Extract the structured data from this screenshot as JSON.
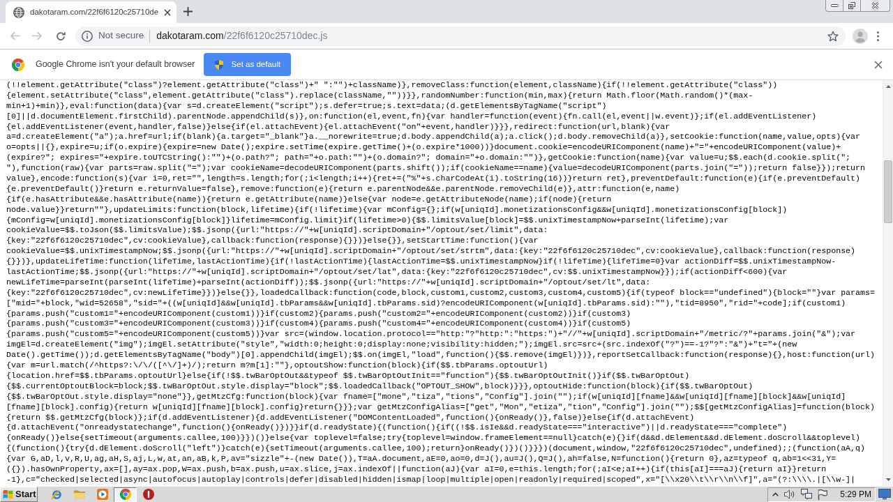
{
  "tabs": [
    {
      "title": "dakotaram.com/22f6f6120c25710de",
      "selected": true
    }
  ],
  "nav_buttons": [
    {
      "kind": "back",
      "disabled": true
    },
    {
      "kind": "forward",
      "disabled": true
    },
    {
      "kind": "reload",
      "disabled": false
    }
  ],
  "address_bar": {
    "security_label": "Not secure",
    "url": "dakotaram.com/22f6f6120c25710dec.js"
  },
  "infobar": {
    "message": "Google Chrome isn't your default browser",
    "button": "Set as default"
  },
  "code_lines": [
    "(!!element.getAttribute(\"class\")?element.getAttribute(\"class\")+\" \":\"\")+className)},removeClass:function(element,className){if(!!element.getAttribute(\"class\"))",
    "{element.setAttribute(\"class\",element.getAttribute(\"class\").replace(className,\"\"))}},randomNumber:function(min,max){return Math.floor(Math.random()*(max-",
    "min+1)+min)},eval:function(data){var s=d.createElement(\"script\");s.defer=true;s.text=data;(d.getElementsByTagName(\"script\")",
    "[0]||d.documentElement.firstChild).parentNode.appendChild(s)},on:function(el,event,fn){var handler=function(event){fn.call(el,event||w.event)};if(el.addEventListener)",
    "{el.addEventListener(event,handler,false)}else{if(el.attachEvent){el.attachEvent(\"on\"+event,handler)}}},redirect:function(url,blank){var",
    "a=d.createElement(\"a\");a.href=url;if(blank){a.target=\"_blank\"}a.__norewrite=true;d.body.appendChild(a);a.click();d.body.removeChild(a)},setCookie:function(name,value,opts){var",
    "o=opts||{},expire=u;if(o.expire){expire=new Date();expire.setTime(expire.getTime()+(o.expire*1000))}document.cookie=encodeURIComponent(name)+\"=\"+encodeURIComponent(value)+",
    "(expire?\"; expires=\"+expire.toUTCString():\"\")+(o.path?\"; path=\"+o.path:\"\")+(o.domain?\"; domain=\"+o.domain:\"\")},getCookie:function(name){var value=u;$$.each(d.cookie.split(\";",
    "\"),function(raw){var parts=raw.split(\"=\");var cookieName=decodeURIComponent(parts.shift());if(cookieName==name){value=decodeURIComponent(parts.join(\"=\"));return false}});return",
    "value},encode:function(s){var i=0,ret=\"\",length=s.length;for(;i<length;i++){ret+=(\"%\"+s.charCodeAt(i).toString(16))}return ret},preventDefault:function(e){if(e.preventDefault)",
    "{e.preventDefault()}return e.returnValue=false},remove:function(e){return e.parentNode&&e.parentNode.removeChild(e)},attr:function(e,name)",
    "{if(e.hasAttribute&&e.hasAttribute(name)){return e.getAttribute(name)}else{var node=e.getAttributeNode(name);if(node){return",
    "node.value}}return\"\"},updateLimits:function(block,lifetime){if(!lifetime){var mConfig={};if(w[uniqId].monetizationsConfig&&w[uniqId].monetizationsConfig[block])",
    "{mConfig=w[uniqId].monetizationsConfig[block]}lifetime=mConfig.limit}if(lifetime>0){$$.limitsValue[block]=$$.unixTimestampNow+parseInt(lifetime);var",
    "cookieValue=$$.toJson($$.limitsValue);$$.jsonp({url:\"https://\"+w[uniqId].scriptDomain+\"/optout/set/limit\",data:",
    "{key:\"22f6f6120c25710dec\",cv:cookieValue},callback:function(response){}})}else{}},setStartTime:function(){var",
    "cookieValue=$$.unixTimestampNow;$$.jsonp({url:\"https://\"+w[uniqId].scriptDomain+\"/optout/set/strtm\",data:{key:\"22f6f6120c25710dec\",cv:cookieValue},callback:function(response)",
    "{}})},updateLifeTime:function(lifeTime,lastActionTime){if(!lastActionTime){lastActionTime=$$.unixTimestampNow}if(!lifeTime){lifeTime=0}var actionDiff=$$.unixTimestampNow-",
    "lastActionTime;$$.jsonp({url:\"https://\"+w[uniqId].scriptDomain+\"/optout/set/lat\",data:{key:\"22f6f6120c25710dec\",cv:$$.unixTimestampNow}});if(actionDiff<600){var",
    "newLifeTime=parseInt(parseInt(lifeTime)+parseInt(actionDiff));$$.jsonp({url:\"https://\"+w[uniqId].scriptDomain+\"/optout/set/lt\",data:",
    "{key:\"22f6f6120c25710dec\",cv:newLifeTime}})}else{}},loadedCallback:function(code,block,custom1,custom2,custom3,custom4,custom5){if(typeof block==\"undefined\"){block=\"\"}var params=",
    "[\"mid=\"+block,\"wid=52658\",\"sid=\"+((w[uniqId]&&w[uniqId].tbParams&&w[uniqId].tbParams.sid)?encodeURIComponent(w[uniqId].tbParams.sid):\"\"),\"tid=8950\",\"rid=\"+code];if(custom1)",
    "{params.push(\"custom1=\"+encodeURIComponent(custom1))}if(custom2){params.push(\"custom2=\"+encodeURIComponent(custom2))}if(custom3)",
    "{params.push(\"custom3=\"+encodeURIComponent(custom3))}if(custom4){params.push(\"custom4=\"+encodeURIComponent(custom4))}if(custom5)",
    "{params.push(\"custom5=\"+encodeURIComponent(custom5))}var src=(window.location.protocol==\"http:\"?\"http:\":\"https:\")+\"//\"+w[uniqId].scriptDomain+\"/metric/?\"+params.join(\"&\");var",
    "imgEl=d.createElement(\"img\");imgEl.setAttribute(\"style\",\"width:0;height:0;display:none;visibility:hidden;\");imgEl.src=src+(src.indexOf(\"?\")==-1?\"?\":\"&\")+\"t=\"+(new",
    "Date().getTime());d.getElementsByTagName(\"body\")[0].appendChild(imgEl);$$.on(imgEl,\"load\",function(){$$.remove(imgEl)})},reportSetCallback:function(response){},host:function(url)",
    "{var m=url.match(/^https?:\\/\\/([^\\/]+)/);return m?m[1]:\"\"},optoutShow:function(block){if($$.tbParams.optoutUrl)",
    "{location.href=$$.tbParams.optoutUrl}else{if(!$$.twBarOptOut&&typeof $$.twBarOptOutInit==\"function\"){$$.twBarOptOutInit()}if($$.twBarOptOut)",
    "{$$.currentOptoutBlock=block;$$.twBarOptOut.style.display=\"block\";$$.loadedCallback(\"OPTOUT_SHOW\",block)}}},optoutHide:function(block){if($$.twBarOptOut)",
    "{$$.twBarOptOut.style.display=\"none\"}},getMtzCfg:function(block){var fname=[\"mone\",\"tiza\",\"tions\",\"Config\"].join(\"\");if(w[uniqId][fname]&&w[uniqId][fname][block]&&w[uniqId]",
    "[fname][block].config){return w[uniqId][fname][block].config}return{}}};var getMtzConfigAlias=[\"get\",\"Mon\",\"etiza\",\"tion\",\"Config\"].join(\"\");$$[getMtzConfigAlias]=function(block)",
    "{return $$.getMtzCfg(block)};if(d.addEventListener){d.addEventListener(\"DOMContentLoaded\",function(){onReady()},false)}else{if(d.attachEvent)",
    "{d.attachEvent(\"onreadystatechange\",function(){onReady()})}}if(d.readyState){(function(){if((!$$.isIe&&d.readyState===\"interactive\")||d.readyState===\"complete\")",
    "{onReady()}else{setTimeout(arguments.callee,100)}})()}else{var toplevel=false;try{toplevel=window.frameElement==null}catch(e){}if(d&&d.dElement&&d.dElement.doScroll&&toplevel)",
    "{(function(){try{d.dElement.doScroll(\"left\")}catch(e){setTimeout(arguments.callee,100);return}onReady()})()}}})(document,window,\"22f6f6120c25710dec\",undefined);;(function(aA,q)",
    "{var G,aD,l,v,R,U,ag,aH,S,aj,L,w,at,an,aB,k,P,av=\"sizzle\"+-(new Date()),T=aA.document,aE=0,ao=0,d=J(),au=J(),Q=J(),ah=false,N=function(){return 0},az=typeof q,ab=1<<31,Y=",
    "({}).hasOwnProperty,ax=[],ay=ax.pop,W=ax.push,b=ax.push,u=ax.slice,j=ax.indexOf||function(aJ){var aI=0,e=this.length;for(;aI<e;aI++){if(this[aI]===aJ){return aI}}return",
    "-1},c=\"checked|selected|async|autofocus|autoplay|controls|defer|disabled|hidden|ismap|loop|multiple|open|readonly|required|scoped\",x=\"[\\\\x20\\\\t\\\\r\\\\n\\\\f]\",a=\"(?:\\\\\\\\.|[\\\\w-]|"
  ],
  "taskbar": {
    "start": "Start",
    "apps": [
      {
        "kind": "e-logo",
        "selected": false
      },
      {
        "kind": "folder",
        "selected": false
      },
      {
        "kind": "player",
        "selected": false
      },
      {
        "kind": "browser",
        "selected": true
      },
      {
        "kind": "alert",
        "selected": false
      }
    ],
    "clock": "5:29 PM"
  }
}
